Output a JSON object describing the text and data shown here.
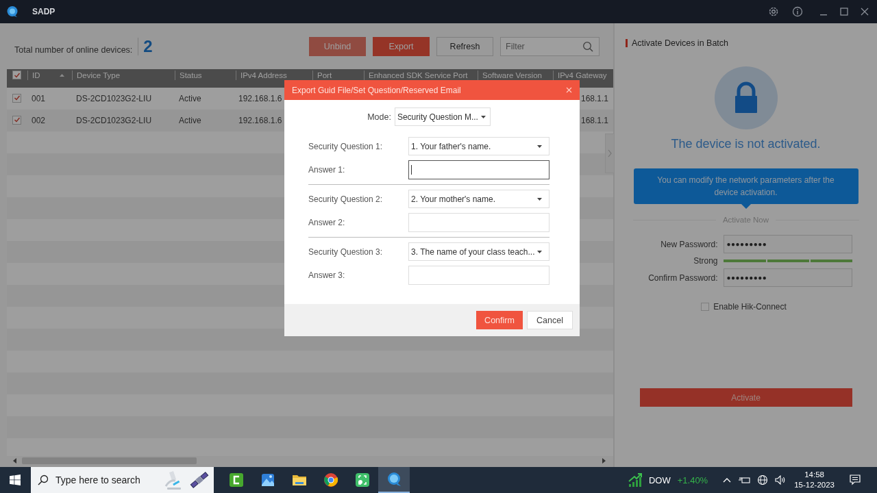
{
  "window": {
    "title": "SADP"
  },
  "summary": {
    "label": "Total number of online devices:",
    "count": "2"
  },
  "toolbar": {
    "buttons": [
      {
        "label": "Unbind",
        "kind": "plain",
        "disabled": true
      },
      {
        "label": "Export",
        "kind": "primary",
        "disabled": false
      },
      {
        "label": "Refresh",
        "kind": "plain",
        "disabled": false
      }
    ],
    "filter": {
      "placeholder": "Filter"
    }
  },
  "table": {
    "all_checked": true,
    "columns": [
      {
        "label": "ID",
        "sorted": true
      },
      {
        "label": "Device Type",
        "sorted": false
      },
      {
        "label": "Status",
        "sorted": false
      },
      {
        "label": "IPv4 Address",
        "sorted": false
      },
      {
        "label": "Port",
        "sorted": false
      },
      {
        "label": "Enhanced SDK Service Port",
        "sorted": false
      },
      {
        "label": "Software Version",
        "sorted": false
      },
      {
        "label": "IPv4 Gateway",
        "sorted": false
      }
    ],
    "rows": [
      {
        "checked": true,
        "id": "001",
        "device_type": "DS-2CD1023G2-LIU",
        "status": "Active",
        "ipv4_address": "192.168.1.6",
        "ipv4_gateway": "168.1.1"
      },
      {
        "checked": true,
        "id": "002",
        "device_type": "DS-2CD1023G2-LIU",
        "status": "Active",
        "ipv4_address": "192.168.1.6",
        "ipv4_gateway": "168.1.1"
      }
    ]
  },
  "activation_panel": {
    "title": "Activate Devices in Batch",
    "status_text": "The device is not activated.",
    "tip": "You can modify the network parameters after the device activation.",
    "section_label": "Activate Now",
    "new_password": {
      "label": "New Password:",
      "value": "●●●●●●●●●"
    },
    "strength": {
      "label": "Strong",
      "level": 1
    },
    "confirm_password": {
      "label": "Confirm Password:",
      "value": "●●●●●●●●●"
    },
    "hik_connect": {
      "label": "Enable Hik-Connect",
      "checked": false
    },
    "activate_button": "Activate"
  },
  "dialog": {
    "title": "Export Guid File/Set Question/Reserved Email",
    "mode": {
      "label": "Mode:",
      "value": "Security Question M..."
    },
    "questions": [
      {
        "label": "Security Question 1:",
        "value": "1. Your father's name.",
        "answer_label": "Answer 1:",
        "focused": true
      },
      {
        "label": "Security Question 2:",
        "value": "2. Your mother's name.",
        "answer_label": "Answer 2:",
        "focused": false
      },
      {
        "label": "Security Question 3:",
        "value": "3. The name of your class teach...",
        "answer_label": "Answer 3:",
        "focused": false
      }
    ],
    "buttons": [
      {
        "label": "Confirm",
        "kind": "primary"
      },
      {
        "label": "Cancel",
        "kind": "secondary"
      }
    ]
  },
  "taskbar": {
    "search": {
      "placeholder": "Type here to search"
    },
    "apps": [
      {
        "kind": "recorder",
        "active": false
      },
      {
        "kind": "photos",
        "active": false
      },
      {
        "kind": "folder",
        "active": false
      },
      {
        "kind": "browser",
        "active": false
      },
      {
        "kind": "capture",
        "active": false
      },
      {
        "kind": "sadp",
        "active": true
      }
    ],
    "ticker": {
      "symbol": "DOW",
      "change": "+1.40%"
    },
    "clock": {
      "time": "14:58",
      "date": "15-12-2023"
    }
  }
}
